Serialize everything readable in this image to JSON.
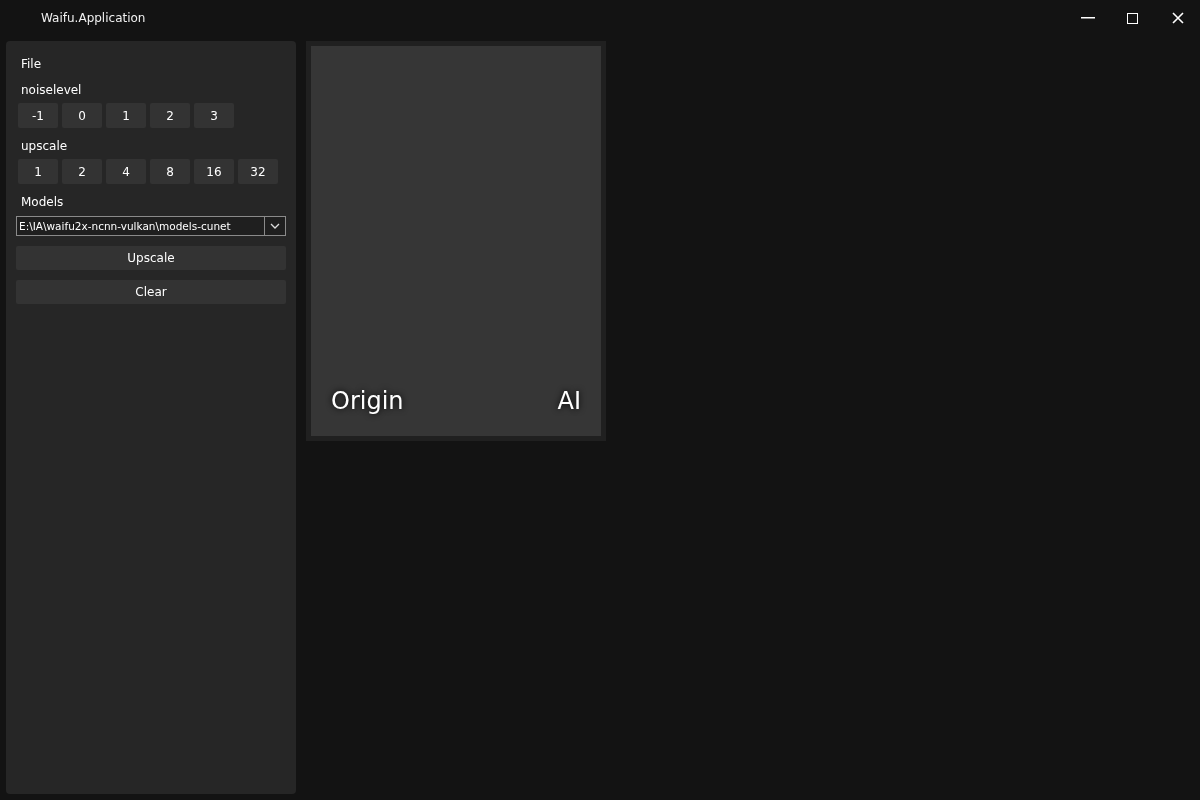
{
  "window": {
    "title": "Waifu.Application"
  },
  "sidebar": {
    "file_label": "File",
    "noiselevel": {
      "label": "noiselevel",
      "options": [
        "-1",
        "0",
        "1",
        "2",
        "3"
      ]
    },
    "upscale": {
      "label": "upscale",
      "options": [
        "1",
        "2",
        "4",
        "8",
        "16",
        "32"
      ]
    },
    "models": {
      "label": "Models",
      "value": "E:\\IA\\waifu2x-ncnn-vulkan\\models-cunet"
    },
    "buttons": [
      "Upscale",
      "Clear"
    ]
  },
  "preview": {
    "left_label": "Origin",
    "right_label": "AI"
  }
}
